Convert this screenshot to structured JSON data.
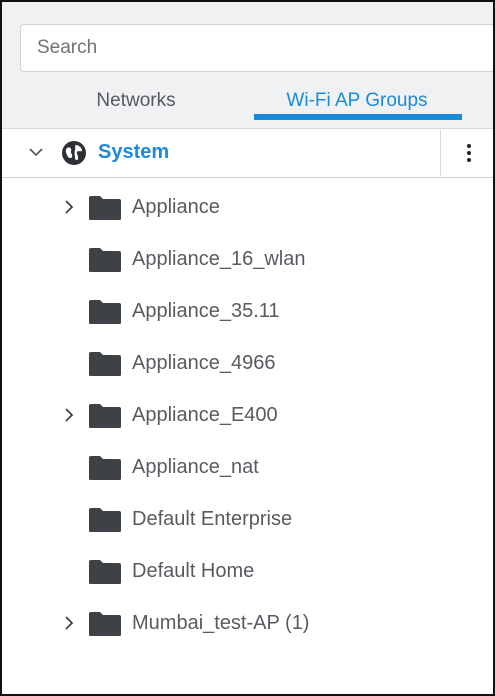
{
  "search": {
    "placeholder": "Search"
  },
  "tabs": [
    {
      "label": "Networks",
      "active": false
    },
    {
      "label": "Wi-Fi AP Groups",
      "active": true
    }
  ],
  "root": {
    "label": "System",
    "expanded": true
  },
  "items": [
    {
      "label": "Appliance",
      "expandable": true
    },
    {
      "label": "Appliance_16_wlan",
      "expandable": false
    },
    {
      "label": "Appliance_35.11",
      "expandable": false
    },
    {
      "label": "Appliance_4966",
      "expandable": false
    },
    {
      "label": "Appliance_E400",
      "expandable": true
    },
    {
      "label": "Appliance_nat",
      "expandable": false
    },
    {
      "label": "Default Enterprise",
      "expandable": false
    },
    {
      "label": "Default Home",
      "expandable": false
    },
    {
      "label": "Mumbai_test-AP (1)",
      "expandable": true
    }
  ],
  "colors": {
    "accent": "#1a8bd8",
    "folder": "#3e4247",
    "text": "#575b60",
    "header_bg": "#f0f1f3"
  },
  "icons": {
    "root_expand": "chevron-down-icon",
    "root": "globe-icon",
    "menu": "kebab-menu-icon",
    "item_expand": "chevron-right-icon",
    "item": "folder-icon"
  }
}
